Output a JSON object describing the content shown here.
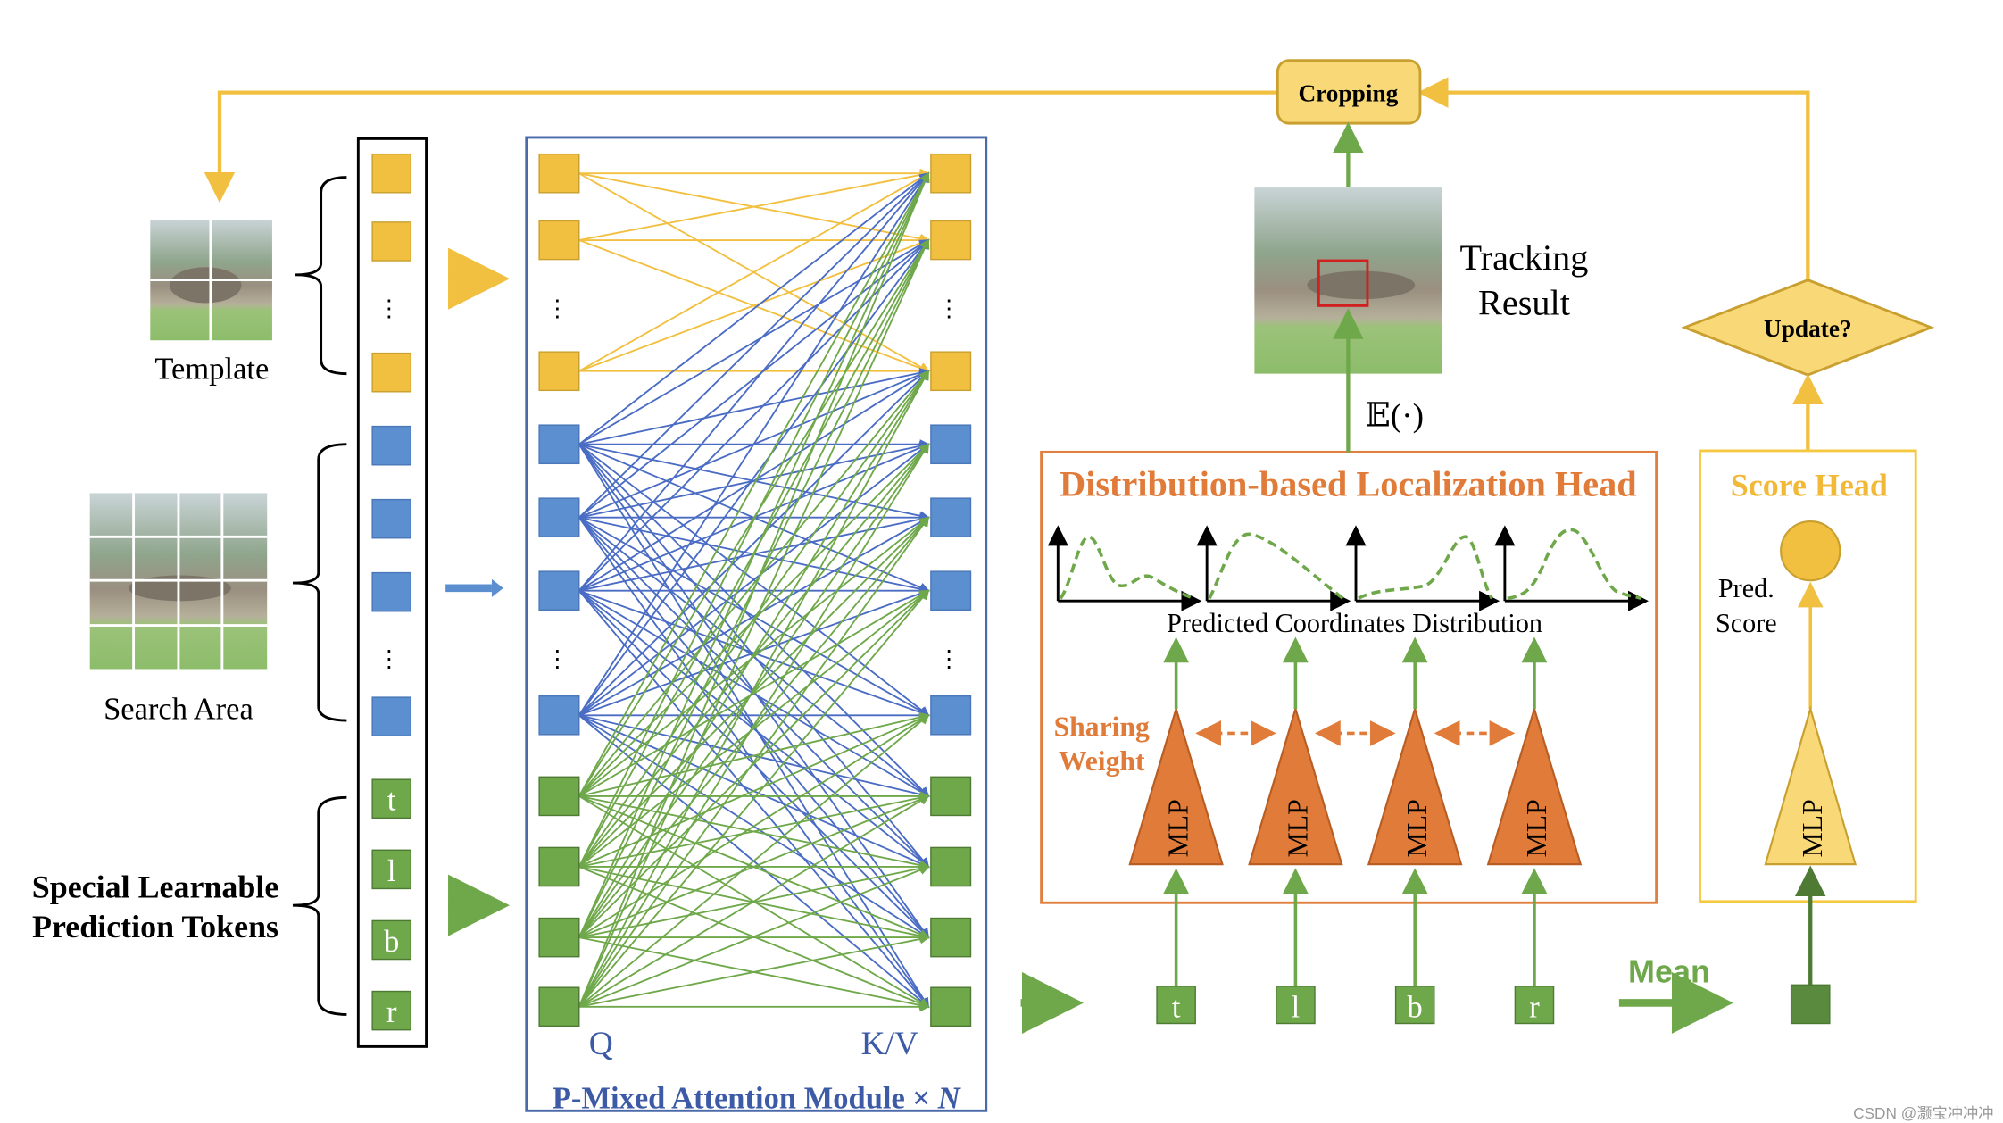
{
  "template": {
    "label": "Template"
  },
  "search": {
    "label": "Search Area"
  },
  "tokens": {
    "label_line1": "Special Learnable",
    "label_line2": "Prediction Tokens",
    "letters": [
      "t",
      "l",
      "b",
      "r"
    ]
  },
  "attention": {
    "q_label": "Q",
    "kv_label": "K/V",
    "title": "P-Mixed Attention Module × ",
    "title_n": "N"
  },
  "cropping": {
    "label": "Cropping"
  },
  "tracking": {
    "line1": "Tracking",
    "line2": "Result",
    "expectation": "𝔼(·)"
  },
  "update": {
    "label": "Update?"
  },
  "loc_head": {
    "title": "Distribution-based Localization Head",
    "dist_label": "Predicted Coordinates Distribution",
    "sharing1": "Sharing",
    "sharing2": "Weight",
    "mlp": "MLP"
  },
  "score_head": {
    "title": "Score Head",
    "pred1": "Pred.",
    "pred2": "Score",
    "mlp": "MLP"
  },
  "mean": {
    "label": "Mean"
  },
  "watermark": "CSDN @灏宝冲冲冲",
  "colors": {
    "yellow": "#f2c040",
    "blue": "#5b8fcf",
    "green": "#6fa84a",
    "orange": "#e07b39",
    "frame_blue": "#4a6aaa",
    "line_blue": "#4a6cc4"
  }
}
